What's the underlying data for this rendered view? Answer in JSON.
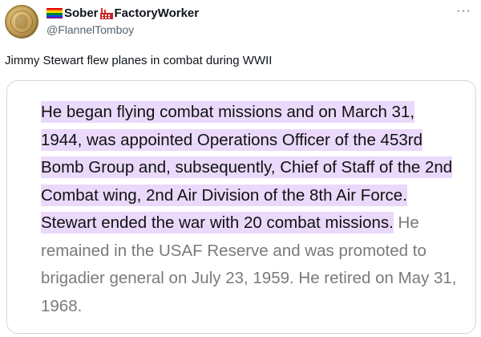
{
  "author": {
    "name_before": "Sober",
    "name_after": "FactoryWorker",
    "handle": "@FlannelTomboy",
    "avatar_icon": "coin-avatar",
    "flag_icon": "rainbow-flag-icon",
    "factory_icon": "factory-icon"
  },
  "menu": {
    "more_label": "···"
  },
  "tweet": {
    "text": "Jimmy Stewart flew planes in combat during WWII"
  },
  "image_quote": {
    "highlighted": "He began flying combat missions and on March 31, 1944, was appointed Operations Officer of the 453rd Bomb Group and, subsequently, Chief of Staff of the 2nd Combat wing, 2nd Air Division of the 8th Air Force. Stewart ended the war with 20 combat missions.",
    "rest": " He remained in the USAF Reserve and was promoted to brigadier general on July 23, 1959. He retired on May 31, 1968."
  },
  "colors": {
    "highlight": "#ead9fb",
    "muted_text": "#7a7a7a",
    "handle": "#536471",
    "border": "#cfd9de"
  }
}
